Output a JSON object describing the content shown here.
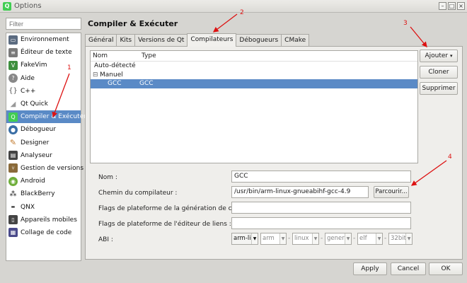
{
  "window": {
    "title": "Options",
    "app_icon": "qt-logo-icon"
  },
  "filter": {
    "placeholder": "Filter"
  },
  "sidebar": {
    "items": [
      {
        "label": "Environnement",
        "icon": "monitor-icon",
        "color": "#5b6b80"
      },
      {
        "label": "Éditeur de texte",
        "icon": "text-editor-icon",
        "color": "#7a7a7a"
      },
      {
        "label": "FakeVim",
        "icon": "vim-icon",
        "color": "#3d8f3d"
      },
      {
        "label": "Aide",
        "icon": "help-icon",
        "color": "#888888"
      },
      {
        "label": "C++",
        "icon": "braces-icon",
        "color": "#666666"
      },
      {
        "label": "Qt Quick",
        "icon": "qtquick-icon",
        "color": "#9a9a9a"
      },
      {
        "label": "Compiler & Exécuter",
        "icon": "build-run-icon",
        "color": "#41cd52"
      },
      {
        "label": "Débogueur",
        "icon": "debugger-icon",
        "color": "#3a6ea5"
      },
      {
        "label": "Designer",
        "icon": "designer-icon",
        "color": "#c0782a"
      },
      {
        "label": "Analyseur",
        "icon": "analyzer-icon",
        "color": "#444444"
      },
      {
        "label": "Gestion de versions",
        "icon": "version-control-icon",
        "color": "#8a6a3a"
      },
      {
        "label": "Android",
        "icon": "android-icon",
        "color": "#6fae3a"
      },
      {
        "label": "BlackBerry",
        "icon": "blackberry-icon",
        "color": "#222222"
      },
      {
        "label": "QNX",
        "icon": "qnx-icon",
        "color": "#333333"
      },
      {
        "label": "Appareils mobiles",
        "icon": "mobile-device-icon",
        "color": "#444444"
      },
      {
        "label": "Collage de code",
        "icon": "code-paste-icon",
        "color": "#4a4a8a"
      }
    ],
    "selected_index": 6
  },
  "page": {
    "title": "Compiler & Exécuter"
  },
  "tabs": [
    {
      "label": "Général"
    },
    {
      "label": "Kits"
    },
    {
      "label": "Versions de Qt"
    },
    {
      "label": "Compilateurs",
      "active": true
    },
    {
      "label": "Débogueurs"
    },
    {
      "label": "CMake"
    }
  ],
  "tree": {
    "columns": [
      "Nom",
      "Type"
    ],
    "rows": [
      {
        "name": "Auto-détecté",
        "type": "",
        "level": 0,
        "expander": ""
      },
      {
        "name": "Manuel",
        "type": "",
        "level": 0,
        "expander": "⊟"
      },
      {
        "name": "GCC",
        "type": "GCC",
        "level": 1,
        "expander": "",
        "selected": true
      }
    ]
  },
  "buttons": {
    "add": "Ajouter",
    "clone": "Cloner",
    "delete": "Supprimer",
    "browse": "Parcourir...",
    "apply": "Apply",
    "cancel": "Cancel",
    "ok": "OK"
  },
  "details": {
    "name_label": "Nom :",
    "name_value": "GCC",
    "path_label": "Chemin du compilateur :",
    "path_value": "/usr/bin/arm-linux-gnueabihf-gcc-4.9",
    "platform_codegen_label": "Flags de plateforme de la génération de code :",
    "platform_codegen_value": "",
    "platform_linker_label": "Flags de plateforme de l'éditeur de liens :",
    "platform_linker_value": "",
    "abi_label": "ABI :",
    "abi_values": [
      "arm-li",
      "arm",
      "linux",
      "generi",
      "elf",
      "32bit"
    ]
  },
  "annotations": [
    "1",
    "2",
    "3",
    "4"
  ],
  "colors": {
    "selection": "#5a8ac6",
    "annotation": "#dd1111"
  }
}
